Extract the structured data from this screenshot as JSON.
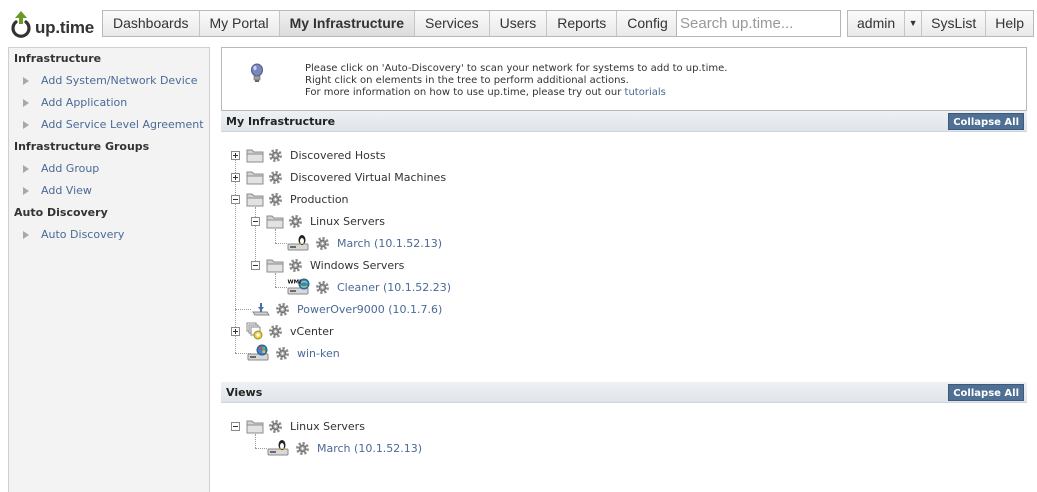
{
  "app": {
    "logo_text": "up.time"
  },
  "nav": {
    "items": [
      "Dashboards",
      "My Portal",
      "My Infrastructure",
      "Services",
      "Users",
      "Reports",
      "Config"
    ],
    "active": "My Infrastructure"
  },
  "search": {
    "placeholder": "Search up.time..."
  },
  "user_menu": {
    "admin_label": "admin",
    "dropdown_glyph": "▼",
    "syslist_label": "SysList",
    "help_label": "Help"
  },
  "sidebar": {
    "groups": [
      {
        "title": "Infrastructure",
        "items": [
          "Add System/Network Device",
          "Add Application",
          "Add Service Level Agreement"
        ]
      },
      {
        "title": "Infrastructure Groups",
        "items": [
          "Add Group",
          "Add View"
        ]
      },
      {
        "title": "Auto Discovery",
        "items": [
          "Auto Discovery"
        ]
      }
    ]
  },
  "info": {
    "line1": "Please click on 'Auto-Discovery' to scan your network for systems to add to up.time.",
    "line2": "Right click on elements in the tree to perform additional actions.",
    "line3_prefix": "For more information on how to use up.time, please try out our ",
    "line3_link": "tutorials"
  },
  "infra_panel": {
    "title": "My Infrastructure",
    "collapse_label": "Collapse All"
  },
  "infra_tree": {
    "discovered_hosts": "Discovered Hosts",
    "discovered_vms": "Discovered Virtual Machines",
    "production": "Production",
    "linux_servers": "Linux Servers",
    "march": "March (10.1.52.13)",
    "windows_servers": "Windows Servers",
    "cleaner": "Cleaner (10.1.52.23)",
    "powerover": "PowerOver9000 (10.1.7.6)",
    "vcenter": "vCenter",
    "winken": "win-ken"
  },
  "views_panel": {
    "title": "Views",
    "collapse_label": "Collapse All"
  },
  "views_tree": {
    "linux_servers": "Linux Servers",
    "march": "March (10.1.52.13)"
  },
  "colors": {
    "accent": "#4f7094",
    "link": "#4a6a96",
    "logo_green": "#6a9a1f"
  }
}
